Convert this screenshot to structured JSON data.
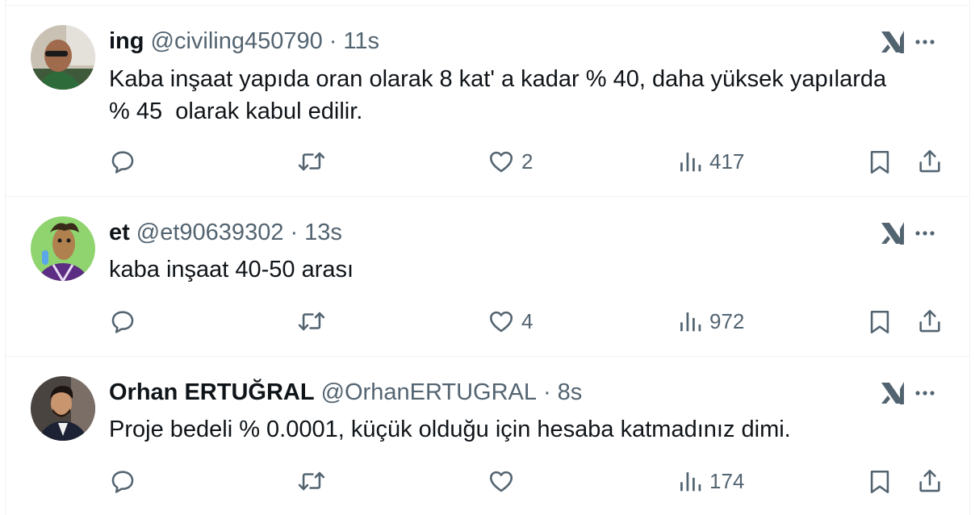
{
  "tweets": [
    {
      "name": "ing",
      "handle": "@civiling450790",
      "separator": "·",
      "time": "11s",
      "text": "Kaba inşaat yapıda oran olarak 8 kat' a kadar % 40, daha yüksek yapılarda\n% 45  olarak kabul edilir.",
      "likes": "2",
      "views": "417"
    },
    {
      "name": "et",
      "handle": "@et90639302",
      "separator": "·",
      "time": "13s",
      "text": "kaba inşaat 40-50 arası",
      "likes": "4",
      "views": "972"
    },
    {
      "name": "Orhan ERTUĞRAL",
      "handle": "@OrhanERTUGRAL",
      "separator": "·",
      "time": "8s",
      "text": "Proje bedeli % 0.0001, küçük olduğu için hesaba katmadınız dimi.",
      "likes": "",
      "views": "174"
    }
  ],
  "icons": {
    "reply": "reply-icon",
    "retweet": "retweet-icon",
    "like": "heart-icon",
    "views": "views-icon",
    "bookmark": "bookmark-icon",
    "share": "share-icon",
    "grok": "grok-icon",
    "more": "more-icon"
  },
  "colors": {
    "text": "#0f1419",
    "secondary": "#536471",
    "divider": "#eff3f4"
  }
}
